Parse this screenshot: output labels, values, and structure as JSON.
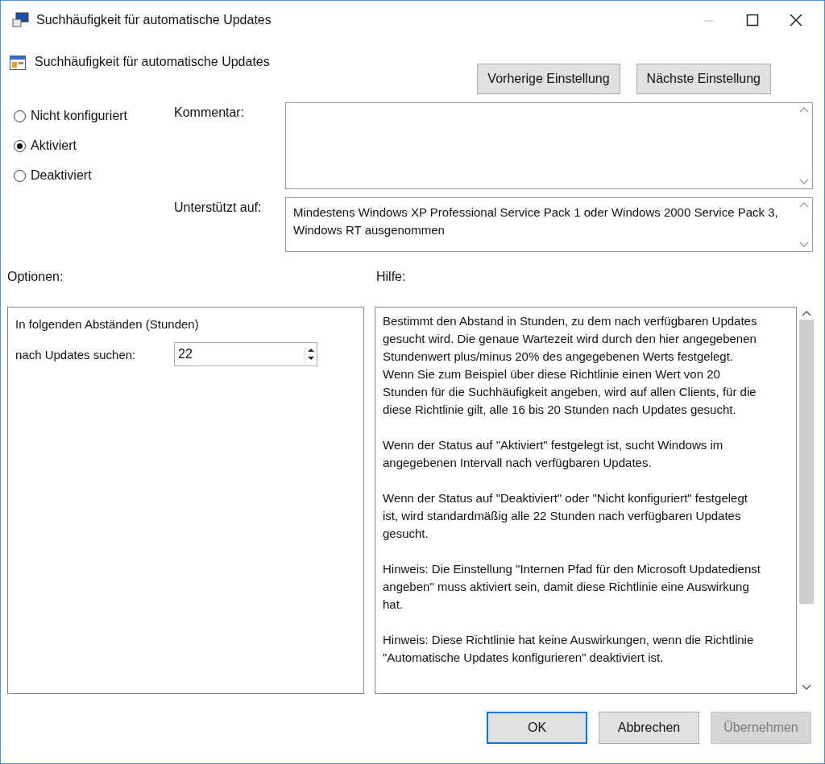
{
  "window": {
    "title": "Suchhäufigkeit für automatische Updates"
  },
  "header": {
    "title": "Suchhäufigkeit für automatische Updates",
    "buttons": [
      {
        "label": "Vorherige Einstellung",
        "disabled": false
      },
      {
        "label": "Nächste Einstellung",
        "disabled": false
      }
    ]
  },
  "states": [
    {
      "label": "Nicht konfiguriert",
      "selected": false
    },
    {
      "label": "Aktiviert",
      "selected": true
    },
    {
      "label": "Deaktiviert",
      "selected": false
    }
  ],
  "comment": {
    "label": "Kommentar:"
  },
  "supported": {
    "label": "Unterstützt auf:",
    "value": "Mindestens Windows XP Professional Service Pack 1 oder Windows 2000 Service Pack 3, Windows RT ausgenommen"
  },
  "options": {
    "label": "Optionen:",
    "caption": "In folgenden Abständen (Stunden)",
    "field_label": "nach Updates suchen:",
    "value": "22"
  },
  "help": {
    "label": "Hilfe:",
    "paragraphs": [
      "Bestimmt den Abstand in Stunden, zu dem nach verfügbaren Updates gesucht wird. Die genaue Wartezeit wird durch den hier angegebenen Stundenwert plus/minus 20% des angegebenen Werts festgelegt. Wenn Sie zum Beispiel über diese Richtlinie einen Wert von 20 Stunden für die Suchhäufigkeit angeben, wird auf allen Clients, für die diese Richtlinie gilt, alle 16 bis 20 Stunden nach Updates gesucht.",
      "Wenn der Status auf \"Aktiviert\" festgelegt ist, sucht Windows im angegebenen Intervall nach verfügbaren Updates.",
      "Wenn der Status auf \"Deaktiviert\" oder \"Nicht konfiguriert\" festgelegt ist, wird standardmäßig alle 22 Stunden nach verfügbaren Updates gesucht.",
      "Hinweis: Die Einstellung \"Internen Pfad für den Microsoft Updatedienst angeben\" muss aktiviert sein, damit diese Richtlinie eine Auswirkung hat.",
      "Hinweis: Diese Richtlinie hat keine Auswirkungen, wenn die Richtlinie \"Automatische Updates konfigurieren\" deaktiviert ist."
    ]
  },
  "buttons": [
    {
      "label": "OK",
      "disabled": false,
      "default": true
    },
    {
      "label": "Abbrechen",
      "disabled": false,
      "default": false
    },
    {
      "label": "Übernehmen",
      "disabled": true,
      "default": false
    }
  ]
}
